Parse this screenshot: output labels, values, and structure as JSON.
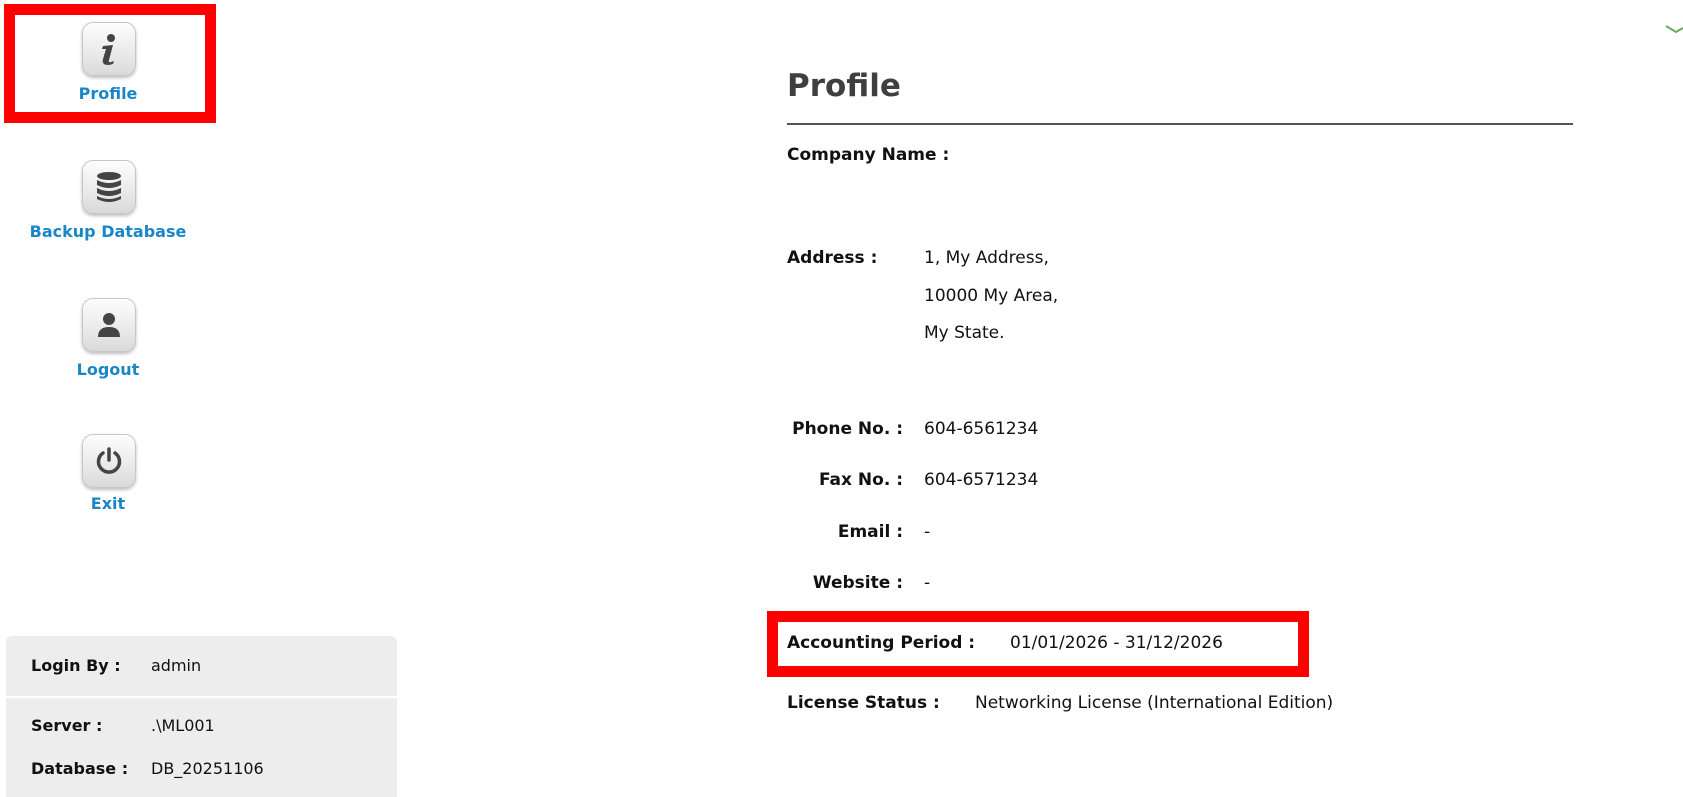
{
  "nav": {
    "items": [
      {
        "label": "Profile",
        "icon": "info-icon"
      },
      {
        "label": "Backup Database",
        "icon": "database-icon"
      },
      {
        "label": "Logout",
        "icon": "user-icon"
      },
      {
        "label": "Exit",
        "icon": "power-icon"
      }
    ]
  },
  "session": {
    "login_label": "Login By :",
    "login_value": "admin",
    "server_label": "Server :",
    "server_value": ".\\ML001",
    "database_label": "Database :",
    "database_value": "DB_20251106"
  },
  "profile": {
    "title": "Profile",
    "company_name_label": "Company Name :",
    "address_label": "Address :",
    "address_lines": [
      "1, My Address,",
      "10000 My Area,",
      "My State."
    ],
    "phone_label": "Phone  No. :",
    "phone_value": "604-6561234",
    "fax_label": "Fax No. :",
    "fax_value": "604-6571234",
    "email_label": "Email :",
    "email_value": "-",
    "website_label": "Website :",
    "website_value": "-",
    "accounting_period_label": "Accounting Period :",
    "accounting_period_value": "01/01/2026 - 31/12/2026",
    "license_status_label": "License Status :",
    "license_status_value": "Networking License (International Edition)"
  },
  "colors": {
    "link": "#1a86c8",
    "highlight": "#ff0000",
    "panel": "#ededed"
  }
}
